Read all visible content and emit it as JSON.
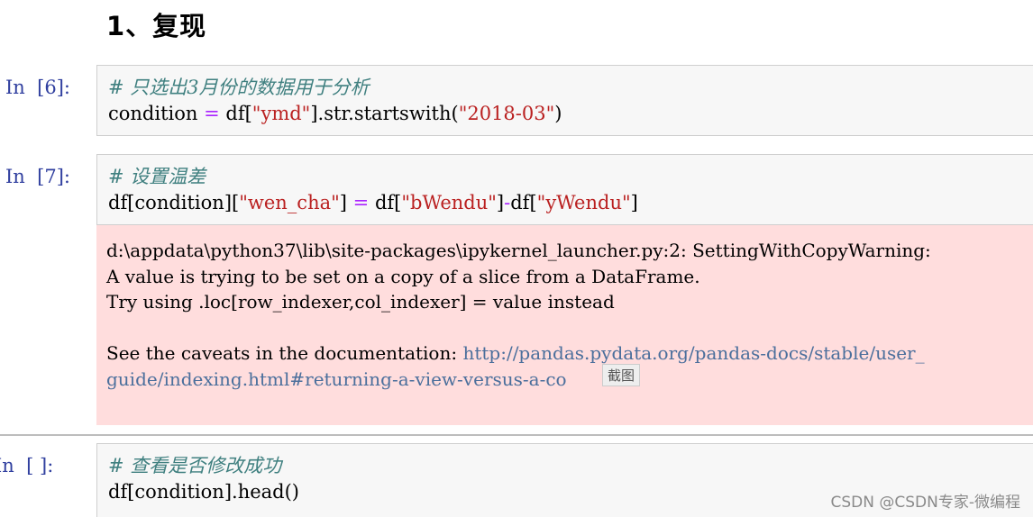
{
  "heading": "1、复现",
  "cells": [
    {
      "prompt": "In  [6]:",
      "comment": "# 只选出3月份的数据用于分析",
      "code": {
        "p1": "condition",
        "p2": " = ",
        "p3": "df[",
        "p4": "\"ymd\"",
        "p5": "].str.startswith(",
        "p6": "\"2018-03\"",
        "p7": ")"
      }
    },
    {
      "prompt": "In  [7]:",
      "comment": "# 设置温差",
      "code": {
        "p1": "df[condition][",
        "p2": "\"wen_cha\"",
        "p3": "] ",
        "p4": "=",
        "p5": " df[",
        "p6": "\"bWendu\"",
        "p7": "]",
        "p8": "-",
        "p9": "df[",
        "p10": "\"yWendu\"",
        "p11": "]"
      }
    },
    {
      "prompt": "In  [ ]:",
      "comment": "# 查看是否修改成功",
      "code": {
        "p1": "df[condition].head()"
      }
    }
  ],
  "output": {
    "line1": "d:\\appdata\\python37\\lib\\site-packages\\ipykernel_launcher.py:2: SettingWithCopyWarning:",
    "line2": "A value is trying to be set on a copy of a slice from a DataFrame.",
    "line3": "Try using .loc[row_indexer,col_indexer] = value instead",
    "line5_text": "See the caveats in the documentation: ",
    "line5_link": "http://pandas.pydata.org/pandas-docs/stable/user_",
    "line6_link": "guide/indexing.html#returning-a-view-versus-a-co",
    "tooltip": "截图"
  },
  "watermark": "CSDN @CSDN专家-微编程"
}
